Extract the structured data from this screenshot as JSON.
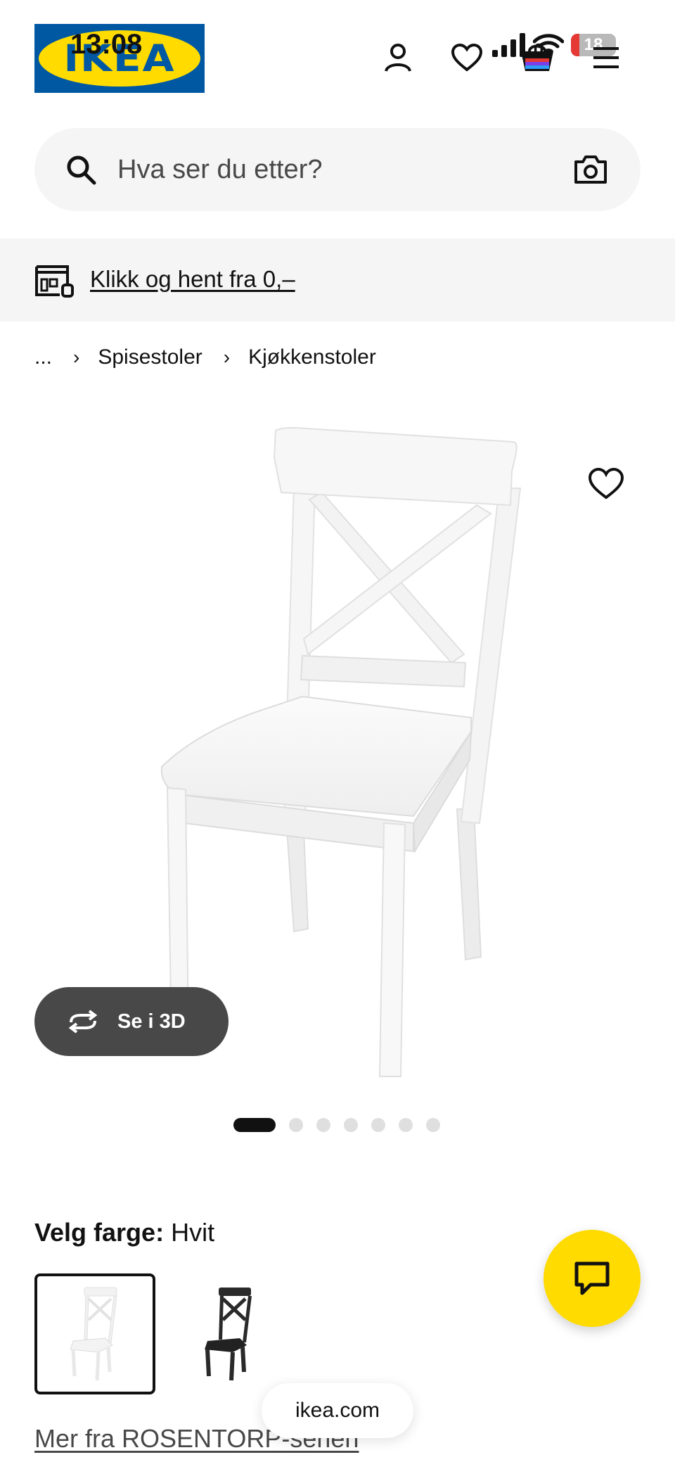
{
  "status_bar": {
    "time": "13:08",
    "battery_level": "18",
    "battery_fraction": 0.18,
    "icons": [
      "signal-icon",
      "wifi-icon",
      "battery-icon"
    ]
  },
  "header": {
    "logo_text": "IKEA",
    "cart_count": "0",
    "icons": [
      "user-icon",
      "heart-icon",
      "cart-icon",
      "menu-icon"
    ]
  },
  "search": {
    "placeholder": "Hva ser du etter?",
    "value": ""
  },
  "banner": {
    "link_text": "Klikk og hent fra 0,–"
  },
  "breadcrumb": {
    "items": [
      "...",
      "Spisestoler",
      "Kjøkkenstoler"
    ]
  },
  "product": {
    "view_3d_label": "Se i 3D",
    "carousel": {
      "total": 7,
      "active_index": 0
    },
    "color_label": "Velg farge:",
    "color_value": "Hvit",
    "swatches": [
      {
        "color": "#f2f2f2",
        "selected": true
      },
      {
        "color": "#2a2a2a",
        "selected": false
      }
    ],
    "series_link": "Mer fra ROSENTORP-serien"
  },
  "browser": {
    "url": "ikea.com"
  },
  "colors": {
    "brand_blue": "#0058a3",
    "brand_yellow": "#ffdb00",
    "surface_gray": "#f5f5f5",
    "dark_pill": "#484848"
  }
}
